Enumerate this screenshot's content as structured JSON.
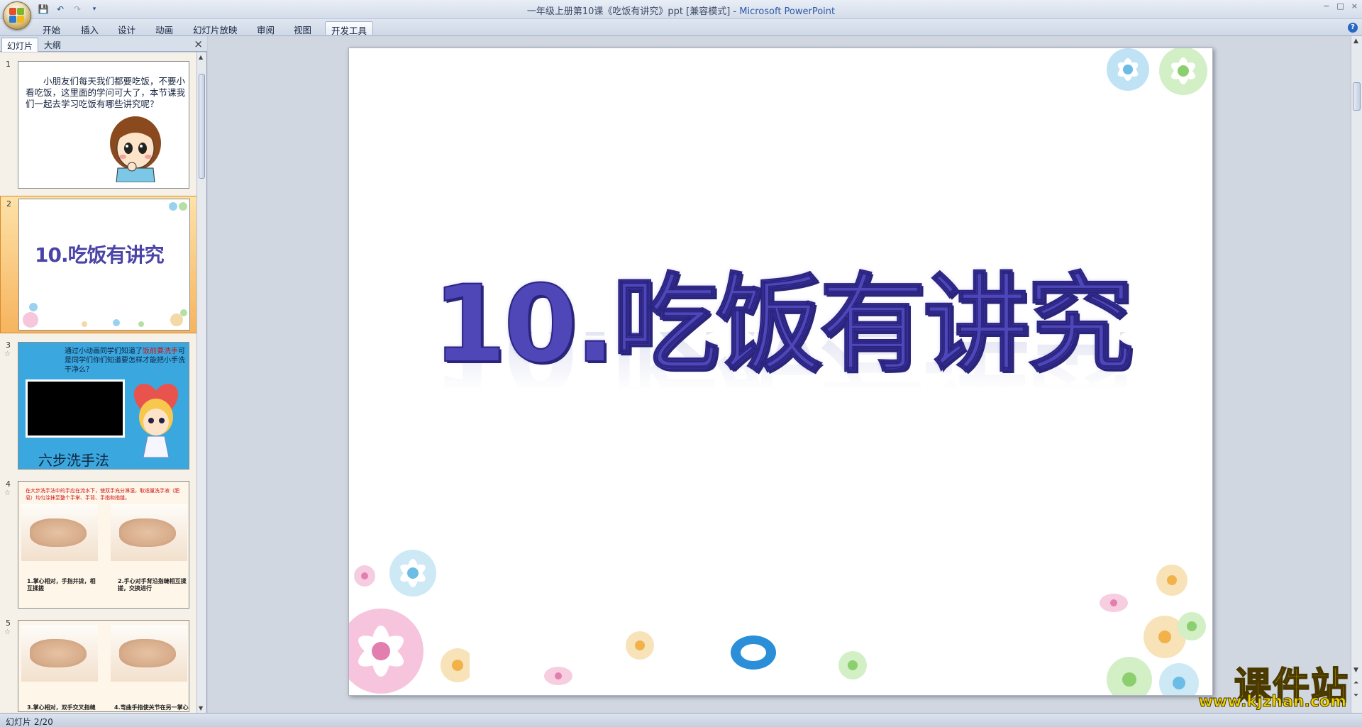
{
  "window": {
    "title": "一年级上册第10课《吃饭有讲究》ppt [兼容模式]",
    "app_name": "Microsoft PowerPoint",
    "controls": [
      "−",
      "□",
      "×"
    ]
  },
  "quick_access": {
    "icons": [
      "save-icon",
      "undo-icon",
      "redo-icon",
      "customize-icon"
    ]
  },
  "ribbon": {
    "tabs": [
      {
        "label": "开始"
      },
      {
        "label": "插入"
      },
      {
        "label": "设计"
      },
      {
        "label": "动画"
      },
      {
        "label": "幻灯片放映"
      },
      {
        "label": "审阅"
      },
      {
        "label": "视图"
      },
      {
        "label": "开发工具",
        "active": true
      }
    ],
    "help": "?"
  },
  "left_pane": {
    "tabs": [
      "幻灯片",
      "大纲"
    ],
    "close": "×",
    "slides": [
      {
        "num": "1",
        "text": "小朋友们每天我们都要吃饭，不要小看吃饭，这里面的学问可大了，本节课我们一起去学习吃饭有哪些讲究呢？"
      },
      {
        "num": "2",
        "title": "10.吃饭有讲究"
      },
      {
        "num": "3",
        "text_pre": "通过小动画同学们知道了",
        "text_red": "饭前要洗手",
        "text_post": "可是同学们你们知道要怎样才能把小手洗干净么？",
        "caption": "六步洗手法"
      },
      {
        "num": "4",
        "red_text": "在大步洗手法中的手应在流水下，使双手充分淋湿，取适量洗手液（肥皂）均匀涂抹至整个手掌、手背、手指和指缝。",
        "label1": "1.掌心相对，手指并拢，相互揉搓",
        "label2": "2.手心对手背沿指缝相互揉搓，交换进行"
      },
      {
        "num": "5",
        "label1": "3.掌心相对，双手交叉指缝",
        "label2": "4.弯曲手指使关节在另一掌心"
      }
    ]
  },
  "main_slide": {
    "title": "10.吃饭有讲究"
  },
  "status_bar": {
    "slide_indicator": "幻灯片 2/20"
  },
  "watermark": {
    "main": "课件站",
    "url": "www.kjzhan.com"
  },
  "colors": {
    "title_purple": "#4f46b8",
    "selection_orange": "#f6b45e",
    "watermark_yellow": "#f0d400"
  }
}
